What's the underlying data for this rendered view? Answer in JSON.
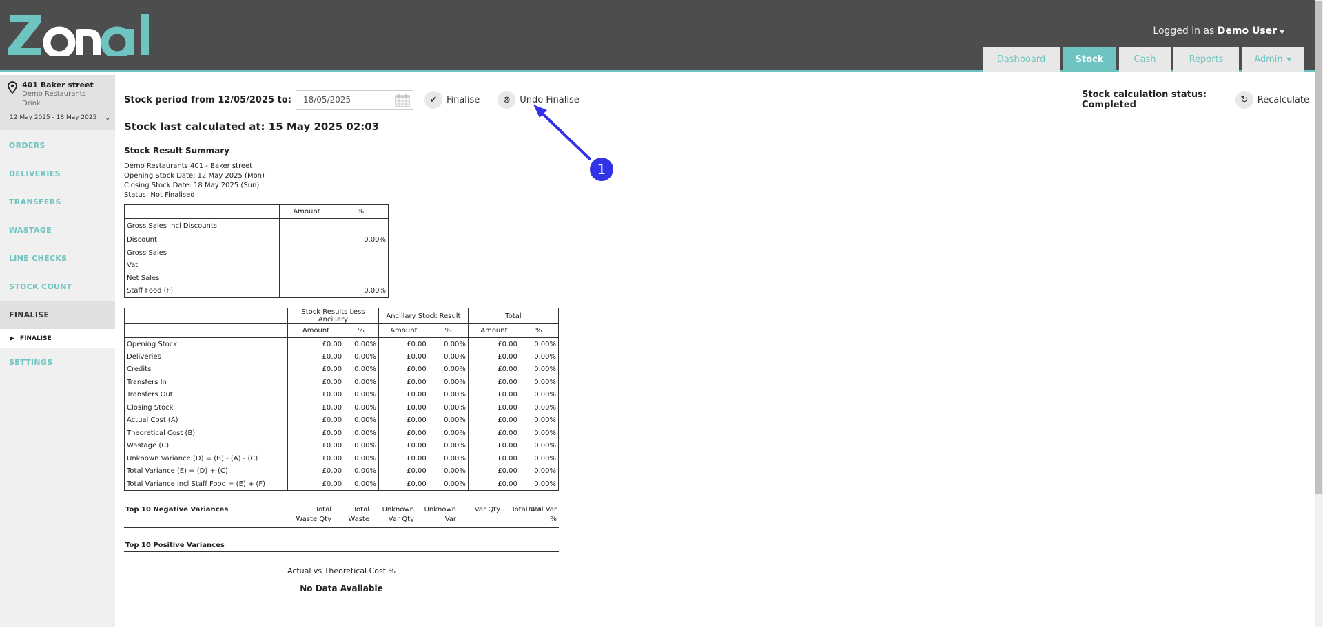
{
  "header": {
    "logo_text": "Zonal",
    "login_prefix": "Logged in as",
    "user": "Demo User",
    "tabs": [
      {
        "label": "Dashboard"
      },
      {
        "label": "Stock"
      },
      {
        "label": "Cash"
      },
      {
        "label": "Reports"
      },
      {
        "label": "Admin"
      }
    ]
  },
  "sidebar": {
    "location_name": "401 Baker street",
    "location_company": "Demo Restaurants",
    "location_dept": "Drink",
    "date_range": "12 May 2025 - 18 May 2025",
    "items": [
      {
        "label": "ORDERS"
      },
      {
        "label": "DELIVERIES"
      },
      {
        "label": "TRANSFERS"
      },
      {
        "label": "WASTAGE"
      },
      {
        "label": "LINE CHECKS"
      },
      {
        "label": "STOCK COUNT"
      },
      {
        "label": "FINALISE"
      }
    ],
    "sub_item": "FINALISE",
    "settings": "SETTINGS"
  },
  "toolbar": {
    "period_label": "Stock period from 12/05/2025 to:",
    "date_value": "18/05/2025",
    "finalise": "Finalise",
    "undo_finalise": "Undo Finalise",
    "calc_status": "Stock calculation status: Completed",
    "recalculate": "Recalculate"
  },
  "last_calc": "Stock last calculated at: 15 May 2025 02:03",
  "summary": {
    "title": "Stock Result Summary",
    "line1": "Demo Restaurants  401 - Baker street",
    "line2": "Opening Stock Date: 12 May 2025 (Mon)",
    "line3": "Closing Stock Date: 18 May 2025 (Sun)",
    "line4": "Status: Not Finalised"
  },
  "sales_table": {
    "headers": [
      "Amount",
      "%"
    ],
    "rows": [
      {
        "label": "Gross Sales Incl Discounts",
        "amount": "",
        "pct": ""
      },
      {
        "label": "Discount",
        "amount": "",
        "pct": "0.00%"
      },
      {
        "label": "Gross Sales",
        "amount": "",
        "pct": ""
      },
      {
        "label": "Vat",
        "amount": "",
        "pct": ""
      },
      {
        "label": "Net Sales",
        "amount": "",
        "pct": ""
      },
      {
        "label": "Staff Food (F)",
        "amount": "",
        "pct": "0.00%"
      }
    ]
  },
  "stock_table": {
    "groups": [
      "Stock Results Less Ancillary",
      "Ancillary Stock Result",
      "Total"
    ],
    "sub_headers": [
      "Amount",
      "%",
      "Amount",
      "%",
      "Amount",
      "%"
    ],
    "rows": [
      {
        "label": "Opening Stock",
        "v": [
          "£0.00",
          "0.00%",
          "£0.00",
          "0.00%",
          "£0.00",
          "0.00%"
        ]
      },
      {
        "label": "Deliveries",
        "v": [
          "£0.00",
          "0.00%",
          "£0.00",
          "0.00%",
          "£0.00",
          "0.00%"
        ]
      },
      {
        "label": "Credits",
        "v": [
          "£0.00",
          "0.00%",
          "£0.00",
          "0.00%",
          "£0.00",
          "0.00%"
        ]
      },
      {
        "label": "Transfers In",
        "v": [
          "£0.00",
          "0.00%",
          "£0.00",
          "0.00%",
          "£0.00",
          "0.00%"
        ]
      },
      {
        "label": "Transfers Out",
        "v": [
          "£0.00",
          "0.00%",
          "£0.00",
          "0.00%",
          "£0.00",
          "0.00%"
        ]
      },
      {
        "label": "Closing Stock",
        "v": [
          "£0.00",
          "0.00%",
          "£0.00",
          "0.00%",
          "£0.00",
          "0.00%"
        ]
      },
      {
        "label": "Actual Cost (A)",
        "v": [
          "£0.00",
          "0.00%",
          "£0.00",
          "0.00%",
          "£0.00",
          "0.00%"
        ]
      },
      {
        "label": "Theoretical Cost (B)",
        "v": [
          "£0.00",
          "0.00%",
          "£0.00",
          "0.00%",
          "£0.00",
          "0.00%"
        ]
      },
      {
        "label": "Wastage (C)",
        "v": [
          "£0.00",
          "0.00%",
          "£0.00",
          "0.00%",
          "£0.00",
          "0.00%"
        ]
      },
      {
        "label": "Unknown Variance (D) = (B) - (A) - (C)",
        "v": [
          "£0.00",
          "0.00%",
          "£0.00",
          "0.00%",
          "£0.00",
          "0.00%"
        ]
      },
      {
        "label": "Total Variance (E) = (D) + (C)",
        "v": [
          "£0.00",
          "0.00%",
          "£0.00",
          "0.00%",
          "£0.00",
          "0.00%"
        ]
      },
      {
        "label": "Total Variance incl Staff Food = (E) + (F)",
        "v": [
          "£0.00",
          "0.00%",
          "£0.00",
          "0.00%",
          "£0.00",
          "0.00%"
        ]
      }
    ]
  },
  "negative": {
    "title": "Top 10 Negative Variances",
    "cols": [
      {
        "l1": "Total",
        "l2": "Waste Qty"
      },
      {
        "l1": "Total",
        "l2": "Waste"
      },
      {
        "l1": "Unknown",
        "l2": "Var Qty"
      },
      {
        "l1": "Unknown",
        "l2": "Var"
      },
      {
        "l1": "Var Qty",
        "l2": ""
      },
      {
        "l1": "Total Var",
        "l2": ""
      },
      {
        "l1": "Total Var",
        "l2": "%"
      }
    ]
  },
  "positive": {
    "title": "Top 10 Positive Variances"
  },
  "chart": {
    "title": "Actual vs Theoretical Cost %",
    "empty": "No Data Available"
  },
  "annotation": {
    "number": "1"
  },
  "colors": {
    "accent": "#6ec4c0",
    "header": "#4d4d4d",
    "annotation": "#3232e6"
  }
}
